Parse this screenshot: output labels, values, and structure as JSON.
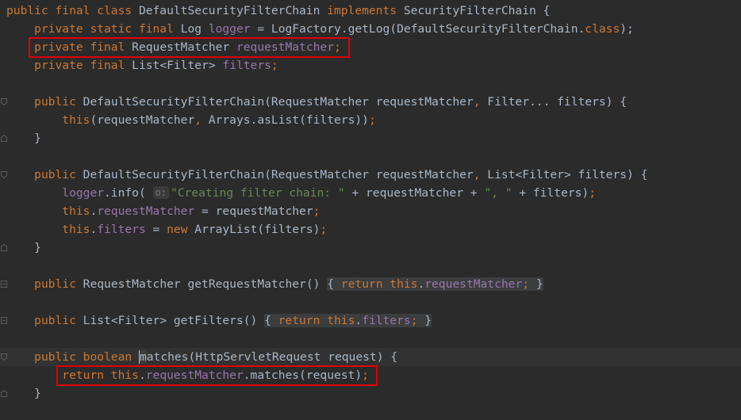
{
  "editor": {
    "lines": [
      {
        "segments": [
          [
            "kw",
            "public final class "
          ],
          [
            "txt",
            "DefaultSecurityFilterChain "
          ],
          [
            "kw",
            "implements "
          ],
          [
            "txt",
            "SecurityFilterChain {"
          ]
        ]
      },
      {
        "segments": [
          [
            "txt",
            "    "
          ],
          [
            "kw",
            "private static final "
          ],
          [
            "txt",
            "Log "
          ],
          [
            "fld",
            "logger"
          ],
          [
            "txt",
            " = LogFactory."
          ],
          [
            "txt",
            "getLog"
          ],
          [
            "txt",
            "(DefaultSecurityFilterChain."
          ],
          [
            "kw",
            "class"
          ],
          [
            "txt",
            ");"
          ]
        ]
      },
      {
        "segments": [
          [
            "txt",
            "    "
          ],
          [
            "kw",
            "private final "
          ],
          [
            "txt",
            "RequestMatcher "
          ],
          [
            "fld",
            "requestMatcher"
          ],
          [
            "kw",
            ";"
          ]
        ]
      },
      {
        "segments": [
          [
            "txt",
            "    "
          ],
          [
            "kw",
            "private final "
          ],
          [
            "txt",
            "List<Filter> "
          ],
          [
            "fld",
            "filters"
          ],
          [
            "kw",
            ";"
          ]
        ]
      },
      {
        "segments": []
      },
      {
        "segments": [
          [
            "txt",
            "    "
          ],
          [
            "kw",
            "public "
          ],
          [
            "txt",
            "DefaultSecurityFilterChain(RequestMatcher requestMatcher"
          ],
          [
            "kw",
            ", "
          ],
          [
            "txt",
            "Filter... filters) {"
          ]
        ]
      },
      {
        "segments": [
          [
            "txt",
            "        "
          ],
          [
            "kw",
            "this"
          ],
          [
            "txt",
            "(requestMatcher"
          ],
          [
            "kw",
            ", "
          ],
          [
            "txt",
            "Arrays."
          ],
          [
            "txt",
            "asList"
          ],
          [
            "txt",
            "(filters))"
          ],
          [
            "kw",
            ";"
          ]
        ]
      },
      {
        "segments": [
          [
            "txt",
            "    }"
          ]
        ]
      },
      {
        "segments": []
      },
      {
        "segments": [
          [
            "txt",
            "    "
          ],
          [
            "kw",
            "public "
          ],
          [
            "txt",
            "DefaultSecurityFilterChain(RequestMatcher requestMatcher"
          ],
          [
            "kw",
            ", "
          ],
          [
            "txt",
            "List<Filter> filters) {"
          ]
        ]
      },
      {
        "segments": [
          [
            "txt",
            "        "
          ],
          [
            "fld",
            "logger"
          ],
          [
            "txt",
            ".info( "
          ],
          [
            "hint",
            "o:"
          ],
          [
            "str",
            "\"Creating filter chain: \""
          ],
          [
            "txt",
            " + requestMatcher + "
          ],
          [
            "str",
            "\", \""
          ],
          [
            "txt",
            " + filters)"
          ],
          [
            "kw",
            ";"
          ]
        ]
      },
      {
        "segments": [
          [
            "txt",
            "        "
          ],
          [
            "kw",
            "this"
          ],
          [
            "txt",
            "."
          ],
          [
            "fld",
            "requestMatcher"
          ],
          [
            "txt",
            " = requestMatcher"
          ],
          [
            "kw",
            ";"
          ]
        ]
      },
      {
        "segments": [
          [
            "txt",
            "        "
          ],
          [
            "kw",
            "this"
          ],
          [
            "txt",
            "."
          ],
          [
            "fld",
            "filters"
          ],
          [
            "txt",
            " = "
          ],
          [
            "kw",
            "new "
          ],
          [
            "txt",
            "ArrayList(filters)"
          ],
          [
            "kw",
            ";"
          ]
        ]
      },
      {
        "segments": [
          [
            "txt",
            "    }"
          ]
        ]
      },
      {
        "segments": []
      },
      {
        "segments": [
          [
            "txt",
            "    "
          ],
          [
            "kw",
            "public "
          ],
          [
            "txt",
            "RequestMatcher getRequestMatcher() "
          ],
          [
            "fold-open",
            "{ "
          ],
          [
            "kw",
            "return this"
          ],
          [
            "txt",
            "."
          ],
          [
            "fld",
            "requestMatcher"
          ],
          [
            "kw",
            "; "
          ],
          [
            "fold-close",
            "}"
          ]
        ]
      },
      {
        "segments": []
      },
      {
        "segments": [
          [
            "txt",
            "    "
          ],
          [
            "kw",
            "public "
          ],
          [
            "txt",
            "List<Filter> getFilters() "
          ],
          [
            "fold-open",
            "{ "
          ],
          [
            "kw",
            "return this"
          ],
          [
            "txt",
            "."
          ],
          [
            "fld",
            "filters"
          ],
          [
            "kw",
            "; "
          ],
          [
            "fold-close",
            "}"
          ]
        ]
      },
      {
        "segments": []
      },
      {
        "segments": [
          [
            "txt",
            "    "
          ],
          [
            "kw",
            "public boolean "
          ],
          [
            "caret",
            "m"
          ],
          [
            "txt",
            "atches(HttpServletRequest request) {"
          ]
        ]
      },
      {
        "segments": [
          [
            "txt",
            "        "
          ],
          [
            "kw",
            "return this"
          ],
          [
            "txt",
            "."
          ],
          [
            "fld",
            "requestMatcher"
          ],
          [
            "txt",
            ".matches(request)"
          ],
          [
            "kw",
            ";"
          ]
        ]
      },
      {
        "segments": [
          [
            "txt",
            "    }"
          ]
        ]
      }
    ],
    "current_line": 19,
    "gutter_marks": [
      {
        "line": 5,
        "icon": "fold-start-icon"
      },
      {
        "line": 7,
        "icon": "fold-end-icon"
      },
      {
        "line": 9,
        "icon": "fold-start-icon"
      },
      {
        "line": 13,
        "icon": "fold-end-icon"
      },
      {
        "line": 15,
        "icon": "fold-toggle-icon"
      },
      {
        "line": 17,
        "icon": "fold-toggle-icon"
      },
      {
        "line": 19,
        "icon": "fold-start-icon"
      },
      {
        "line": 21,
        "icon": "fold-end-icon"
      }
    ],
    "annotations": [
      {
        "name": "highlight-box-requestmatcher-field",
        "line": 2
      },
      {
        "name": "highlight-box-return-statement",
        "line": 20
      }
    ],
    "colors": {
      "background": "#2b2b2b",
      "keyword": "#cc7832",
      "string": "#6a8759",
      "field": "#9876aa",
      "text": "#a9b7c6",
      "highlight": "#e00000"
    }
  }
}
